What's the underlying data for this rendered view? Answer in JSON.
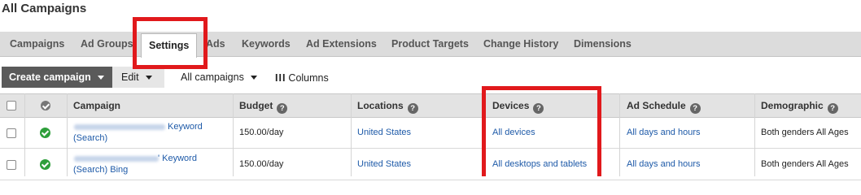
{
  "page": {
    "title": "All Campaigns"
  },
  "tabs": [
    {
      "label": "Campaigns",
      "active": false
    },
    {
      "label": "Ad Groups",
      "active": false
    },
    {
      "label": "Settings",
      "active": true
    },
    {
      "label": "Ads",
      "active": false
    },
    {
      "label": "Keywords",
      "active": false
    },
    {
      "label": "Ad Extensions",
      "active": false
    },
    {
      "label": "Product Targets",
      "active": false
    },
    {
      "label": "Change History",
      "active": false
    },
    {
      "label": "Dimensions",
      "active": false
    }
  ],
  "toolbar": {
    "create_label": "Create campaign",
    "edit_label": "Edit",
    "filter_label": "All campaigns",
    "columns_glyph": "III",
    "columns_label": "Columns"
  },
  "table": {
    "headers": {
      "campaign": "Campaign",
      "budget": "Budget",
      "locations": "Locations",
      "devices": "Devices",
      "ad_schedule": "Ad Schedule",
      "demographic": "Demographic"
    },
    "help_glyph": "?",
    "rows": [
      {
        "campaign_line1": "Keyword",
        "campaign_line2": "(Search)",
        "budget": "150.00/day",
        "locations": "United States",
        "devices": "All devices",
        "ad_schedule": "All days and hours",
        "demographic": "Both genders All Ages"
      },
      {
        "campaign_line1": "' Keyword",
        "campaign_line2": "(Search) Bing",
        "budget": "150.00/day",
        "locations": "United States",
        "devices": "All desktops and tablets",
        "ad_schedule": "All days and hours",
        "demographic": "Both genders All Ages"
      }
    ]
  },
  "colors": {
    "highlight": "#e1191c",
    "link": "#1e5aa8",
    "status_active": "#2e9f3b",
    "create_button": "#5a5a5a"
  },
  "icons": {
    "help": "help-icon",
    "status": "check-circle-icon",
    "caret": "caret-down-icon",
    "columns": "columns-icon"
  }
}
